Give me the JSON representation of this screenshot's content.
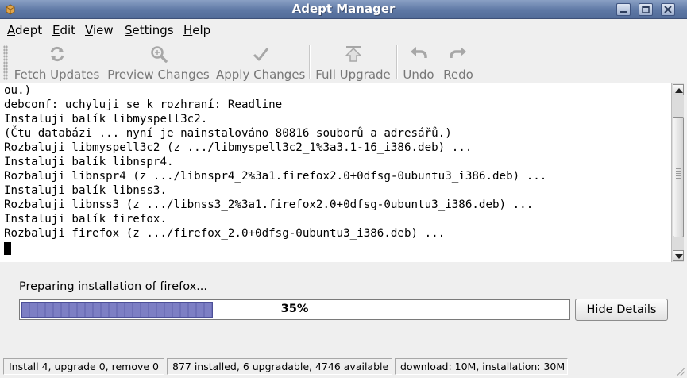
{
  "window": {
    "title": "Adept Manager"
  },
  "menu": [
    "Adept",
    "Edit",
    "View",
    "Settings",
    "Help"
  ],
  "toolbar": {
    "fetch_updates": "Fetch Updates",
    "preview_changes": "Preview Changes",
    "apply_changes": "Apply Changes",
    "full_upgrade": "Full Upgrade",
    "undo": "Undo",
    "redo": "Redo"
  },
  "console": {
    "lines": [
      "ou.)",
      "debconf: uchyluji se k rozhraní: Readline",
      "Instaluji balík libmyspell3c2.",
      "(Čtu databázi ... nyní je nainstalováno 80816 souborů a adresářů.)",
      "Rozbaluji libmyspell3c2 (z .../libmyspell3c2_1%3a3.1-16_i386.deb) ...",
      "Instaluji balík libnspr4.",
      "Rozbaluji libnspr4 (z .../libnspr4_2%3a1.firefox2.0+0dfsg-0ubuntu3_i386.deb) ...",
      "Instaluji balík libnss3.",
      "Rozbaluji libnss3 (z .../libnss3_2%3a1.firefox2.0+0dfsg-0ubuntu3_i386.deb) ...",
      "Instaluji balík firefox.",
      "Rozbaluji firefox (z .../firefox_2.0+0dfsg-0ubuntu3_i386.deb) ..."
    ]
  },
  "progress": {
    "status": "Preparing installation of firefox...",
    "percent_label": "35%",
    "value": 0.35
  },
  "buttons": {
    "hide_details": "Hide Details"
  },
  "statusbar": {
    "changes": "Install 4, upgrade 0, remove 0",
    "packages": "877 installed, 6 upgradable, 4746 available",
    "sizes": "download: 10M, installation: 30M"
  },
  "colors": {
    "titlebar": "#5e78a5",
    "progress_fill": "#7d7fc4"
  }
}
